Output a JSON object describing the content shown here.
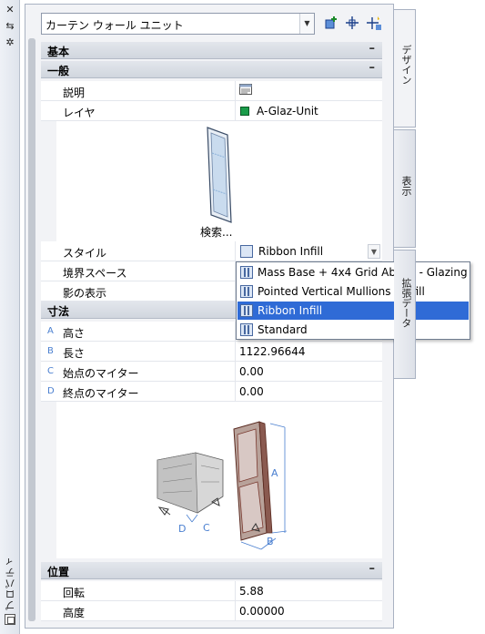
{
  "left_strip": {
    "title": "プロパティ"
  },
  "header": {
    "object_type": "カーテン ウォール ユニット"
  },
  "tabs": [
    "デザイン",
    "表示",
    "拡張データ"
  ],
  "sections": {
    "basic": "基本",
    "general": "一般",
    "dimensions": "寸法",
    "location": "位置",
    "collapse_glyph": "–"
  },
  "general": {
    "description_label": "説明",
    "layer_label": "レイヤ",
    "layer_value": "A-Glaz-Unit",
    "layer_color": "#1a9c4a",
    "preview_caption": "検索...",
    "style_label": "スタイル",
    "style_value": "Ribbon Infill",
    "boundary_label": "境界スペース",
    "shadow_label": "影の表示"
  },
  "style_dropdown": {
    "options": [
      "Mass Base + 4x4 Grid Above - Glazing",
      "Pointed Vertical Mullions - Infill",
      "Ribbon Infill",
      "Standard"
    ],
    "selected_index": 2
  },
  "dimensions": {
    "rows": [
      {
        "letter": "A",
        "label": "高さ",
        "value": ""
      },
      {
        "letter": "B",
        "label": "長さ",
        "value": "1122.96644"
      },
      {
        "letter": "C",
        "label": "始点のマイター",
        "value": "0.00"
      },
      {
        "letter": "D",
        "label": "終点のマイター",
        "value": "0.00"
      }
    ],
    "diagram_labels": [
      "A",
      "B",
      "C",
      "D"
    ]
  },
  "location": {
    "rows": [
      {
        "label": "回転",
        "value": "5.88"
      },
      {
        "label": "高度",
        "value": "0.00000"
      }
    ]
  },
  "colors": {
    "accent": "#2f6bd6",
    "dimension_letters": "#4a7fd0"
  }
}
